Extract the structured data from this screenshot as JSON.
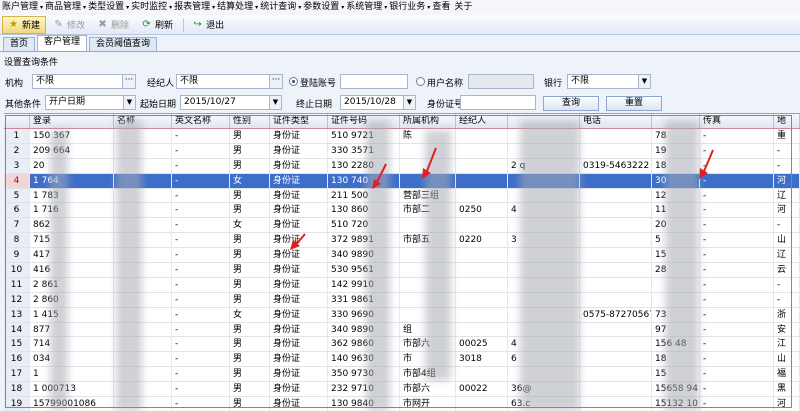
{
  "menu": [
    "账户管理",
    "商品管理",
    "类型设置",
    "实时监控",
    "报表管理",
    "结算处理",
    "统计查询",
    "参数设置",
    "系统管理",
    "银行业务",
    "查看",
    "关于"
  ],
  "toolbar": {
    "new": "新建",
    "edit": "修改",
    "delete": "删除",
    "refresh": "刷新",
    "exit": "退出"
  },
  "tabs": [
    "首页",
    "客户管理",
    "会员阈值查询"
  ],
  "filters": {
    "title": "设置查询条件",
    "org_label": "机构",
    "org_value": "不限",
    "broker_label": "经纪人",
    "broker_value": "不限",
    "login_radio_label": "登陆账号",
    "username_radio_label": "用户名称",
    "bank_label": "银行",
    "bank_value": "不限",
    "other_label": "其他条件",
    "other_value": "开户日期",
    "start_label": "起始日期",
    "start_value": "2015/10/27",
    "end_label": "终止日期",
    "end_value": "2015/10/28",
    "id_label": "身份证号",
    "query_button": "查询",
    "reset_button": "重置"
  },
  "table": {
    "headers": [
      "",
      "登录",
      "名称",
      "英文名称",
      "性别",
      "证件类型",
      "证件号码",
      "所属机构",
      "经纪人",
      "",
      "电话",
      "",
      "传真",
      "地"
    ],
    "rows": [
      [
        "1",
        "150 367",
        "",
        "-",
        "男",
        "身份证",
        "510 9721",
        "陈",
        "",
        "",
        "",
        "78",
        "-",
        "重"
      ],
      [
        "2",
        "209 664",
        "",
        "-",
        "男",
        "身份证",
        "330 3571",
        "",
        "",
        "",
        "",
        "19",
        "-",
        "-"
      ],
      [
        "3",
        "20",
        "",
        "-",
        "男",
        "身份证",
        "130 2280",
        "",
        "",
        "2 q",
        "0319-5463222",
        "18",
        "-",
        "-"
      ],
      [
        "4",
        "1 764",
        "",
        "-",
        "女",
        "身份证",
        "130 740",
        "",
        "",
        "",
        "",
        "30",
        "-",
        "河"
      ],
      [
        "5",
        "1 783",
        "",
        "-",
        "男",
        "身份证",
        "211 500",
        "营部三组",
        "",
        "",
        "",
        "12",
        "-",
        "辽"
      ],
      [
        "6",
        "1 716",
        "",
        "-",
        "男",
        "身份证",
        "130 860",
        "市部二",
        "0250",
        "4",
        "",
        "11",
        "-",
        "河"
      ],
      [
        "7",
        "862",
        "",
        "-",
        "女",
        "身份证",
        "510 720",
        "",
        "",
        "",
        "",
        "20",
        "-",
        "-"
      ],
      [
        "8",
        "715",
        "",
        "-",
        "男",
        "身份证",
        "372 9891",
        "市部五",
        "0220",
        "3",
        "",
        "5",
        "-",
        "山"
      ],
      [
        "9",
        "417",
        "",
        "-",
        "男",
        "身份证",
        "340 9890",
        "",
        "",
        "",
        "",
        "15",
        "-",
        "辽"
      ],
      [
        "10",
        "416",
        "",
        "-",
        "男",
        "身份证",
        "530 9561",
        "",
        "",
        "",
        "",
        "28",
        "-",
        "云"
      ],
      [
        "11",
        "2 861",
        "",
        "-",
        "男",
        "身份证",
        "142 9910",
        "",
        "",
        "",
        "",
        "",
        "-",
        "-"
      ],
      [
        "12",
        "2 860",
        "",
        "-",
        "男",
        "身份证",
        "331 9861",
        "",
        "",
        "",
        "",
        "",
        "-",
        "-"
      ],
      [
        "13",
        "1 415",
        "",
        "-",
        "女",
        "身份证",
        "330 9690",
        "",
        "",
        "",
        "0575-87270567",
        "73",
        "-",
        "浙"
      ],
      [
        "14",
        "877",
        "",
        "-",
        "男",
        "身份证",
        "340 9890",
        "组",
        "",
        "",
        "",
        "97",
        "-",
        "安"
      ],
      [
        "15",
        "714",
        "",
        "-",
        "男",
        "身份证",
        "362 9860",
        "市部六",
        "00025",
        "4",
        "",
        "156 48",
        "-",
        "江"
      ],
      [
        "16",
        "034",
        "",
        "-",
        "男",
        "身份证",
        "140 9630",
        "市",
        "3018",
        "6",
        "",
        "18",
        "-",
        "山"
      ],
      [
        "17",
        "1",
        "",
        "-",
        "男",
        "身份证",
        "350 9730",
        "市部4组",
        "",
        "",
        "",
        "15",
        "-",
        "福"
      ],
      [
        "18",
        "1 000713",
        "",
        "-",
        "男",
        "身份证",
        "232 9710",
        "市部六",
        "00022",
        "36@",
        "",
        "15658 94",
        "-",
        "黑"
      ],
      [
        "19",
        "15799001086",
        "",
        "-",
        "男",
        "身份证",
        "130 9840",
        "市网开",
        "",
        "63.c",
        "",
        "15132 10",
        "-",
        "河"
      ]
    ]
  }
}
